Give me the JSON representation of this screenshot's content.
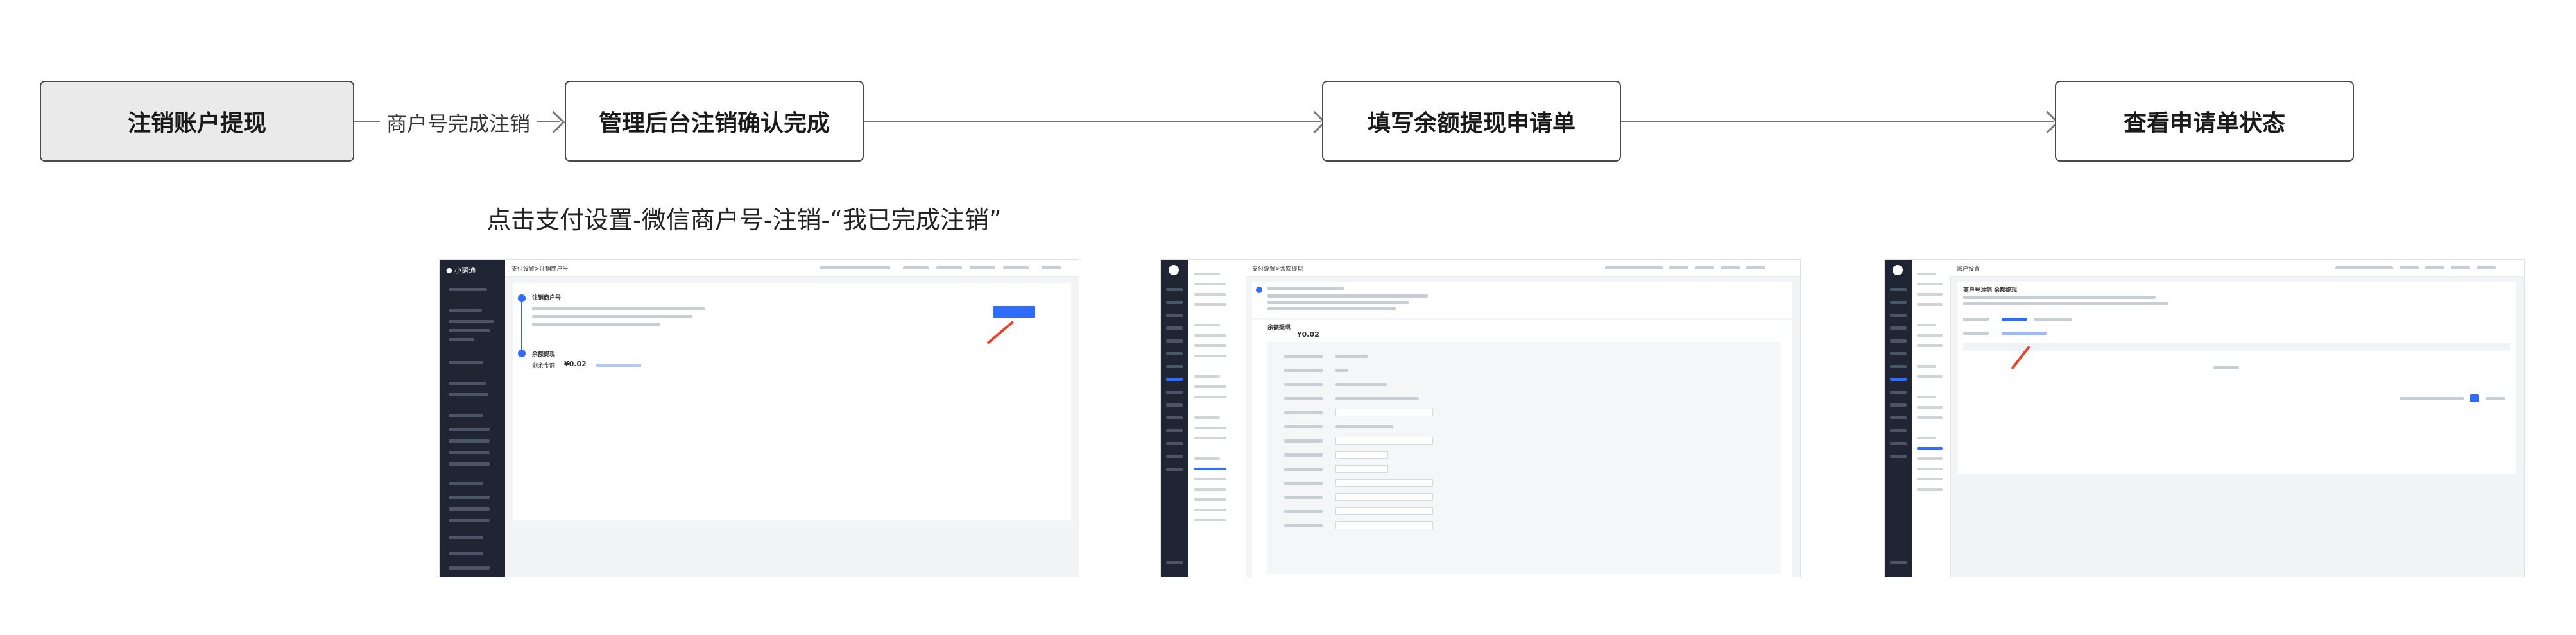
{
  "flow": {
    "steps": [
      {
        "label": "注销账户提现"
      },
      {
        "label": "管理后台注销确认完成"
      },
      {
        "label": "填写余额提现申请单"
      },
      {
        "label": "查看申请单状态"
      }
    ],
    "connector_label": "商户号完成注销",
    "note": "点击支付设置-微信商户号-注销-“我已完成注销”"
  },
  "screenshot1": {
    "logo_text": "小鹅通",
    "header_title": "支付设置>注销商户号",
    "section1_title": "注销商户号",
    "section2_title": "余额提现",
    "balance_label": "剩余金额",
    "balance_value": "¥0.02"
  },
  "screenshot2": {
    "header_title": "支付设置>余额提现",
    "section_title": "余额提现",
    "balance_value": "¥0.02"
  },
  "screenshot3": {
    "header_title": "账户设置",
    "panel_title": "商户号注销 余额提现"
  },
  "colors": {
    "accent": "#2f6bff",
    "arrow_red": "#e8452c",
    "sidebar_dark": "#1f2533"
  }
}
